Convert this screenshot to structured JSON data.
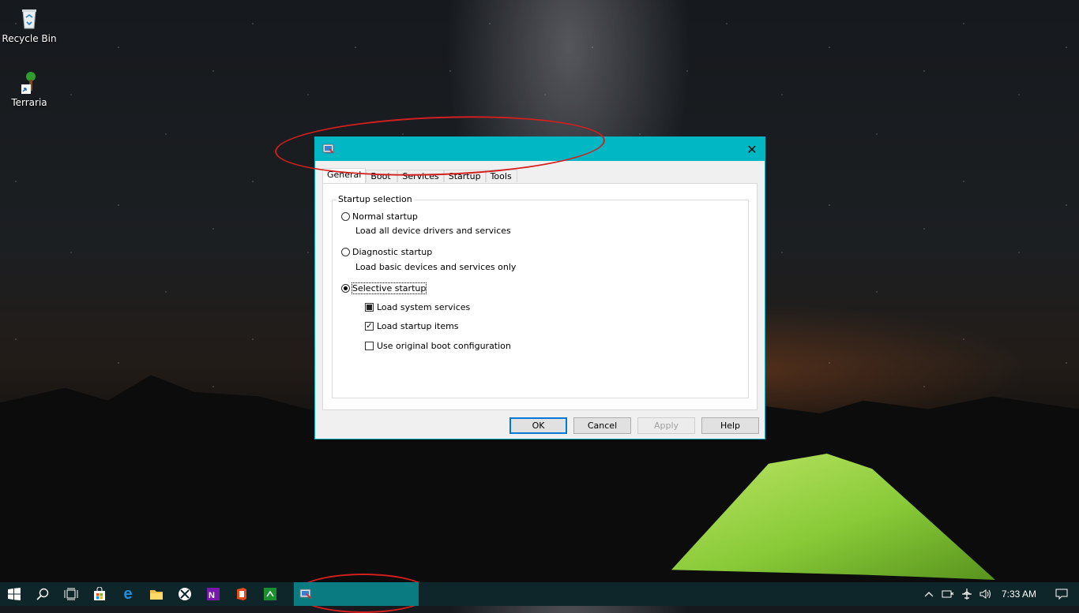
{
  "desktop": {
    "icons": [
      {
        "label": "Recycle Bin",
        "icon": "recycle-bin-icon"
      },
      {
        "label": "Terraria",
        "icon": "terraria-icon"
      }
    ]
  },
  "dialog": {
    "title": "",
    "tabs": [
      "General",
      "Boot",
      "Services",
      "Startup",
      "Tools"
    ],
    "active_tab": "General",
    "group_label": "Startup selection",
    "options": {
      "normal": {
        "label": "Normal startup",
        "desc": "Load all device drivers and services",
        "selected": false
      },
      "diagnostic": {
        "label": "Diagnostic startup",
        "desc": "Load basic devices and services only",
        "selected": false
      },
      "selective": {
        "label": "Selective startup",
        "selected": true
      }
    },
    "checkboxes": {
      "system_services": {
        "label": "Load system services",
        "state": "indeterminate"
      },
      "startup_items": {
        "label": "Load startup items",
        "state": "checked"
      },
      "boot_config": {
        "label": "Use original boot configuration",
        "state": "unchecked"
      }
    },
    "buttons": {
      "ok": "OK",
      "cancel": "Cancel",
      "apply": "Apply",
      "help": "Help"
    }
  },
  "taskbar": {
    "pinned": [
      "windows-start-icon",
      "search-icon",
      "task-view-icon",
      "store-icon",
      "edge-icon",
      "file-explorer-icon",
      "xbox-icon",
      "onenote-icon",
      "office-icon",
      "green-app-icon"
    ],
    "running_app": "system-configuration-icon",
    "clock": "7:33 AM"
  },
  "colors": {
    "accent": "#00b7c3",
    "taskbar": "#0e2629",
    "annotation": "#d41f1f"
  }
}
